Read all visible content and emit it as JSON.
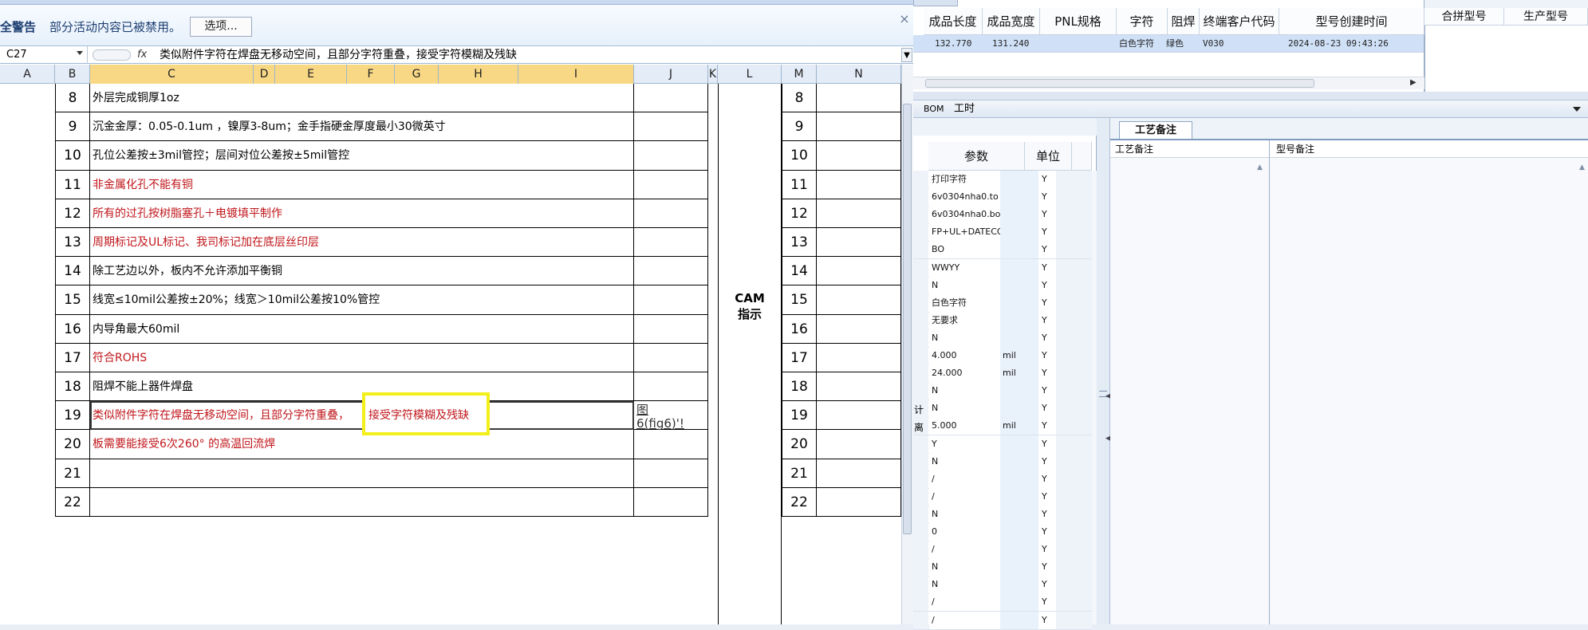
{
  "excel": {
    "security_title": "全警告",
    "security_message": "部分活动内容已被禁用。",
    "options_button": "选项...",
    "close_symbol": "×",
    "name_box": "C27",
    "fx_label": "fx",
    "formula_text": "类似附件字符在焊盘无移动空间，且部分字符重叠，接受字符模糊及残缺",
    "column_headers": [
      "A",
      "B",
      "C",
      "D",
      "E",
      "F",
      "G",
      "H",
      "I",
      "J",
      "K",
      "L",
      "M",
      "N"
    ],
    "rows": [
      {
        "num": "8",
        "text": "外层完成铜厚1oz",
        "red": false
      },
      {
        "num": "9",
        "text": "沉金金厚：0.05-0.1um ，镍厚3-8um；金手指硬金厚度最小30微英寸",
        "red": false
      },
      {
        "num": "10",
        "text": "孔位公差按±3mil管控；层间对位公差按±5mil管控",
        "red": false
      },
      {
        "num": "11",
        "text": "非金属化孔不能有铜",
        "red": true
      },
      {
        "num": "12",
        "text": "所有的过孔按树脂塞孔＋电镀填平制作",
        "red": true
      },
      {
        "num": "13",
        "text": "周期标记及UL标记、我司标记加在底层丝印层",
        "red": true
      },
      {
        "num": "14",
        "text": "除工艺边以外，板内不允许添加平衡铜",
        "red": false
      },
      {
        "num": "15",
        "text": "线宽≤10mil公差按±20%；线宽＞10mil公差按10%管控",
        "red": false
      },
      {
        "num": "16",
        "text": "内导角最大60mil",
        "red": false
      },
      {
        "num": "17",
        "text": "符合ROHS",
        "red": true
      },
      {
        "num": "18",
        "text": "阻焊不能上器件焊盘",
        "red": false
      },
      {
        "num": "19",
        "text": "类似附件字符在焊盘无移动空间，且部分字符重叠，",
        "red": true
      },
      {
        "num": "20",
        "text": "板需要能接受6次260° 的高温回流焊",
        "red": true
      },
      {
        "num": "21",
        "text": "",
        "red": false
      },
      {
        "num": "22",
        "text": "",
        "red": false
      }
    ],
    "highlight_text": "接受字符模糊及残缺",
    "fig_ref_line1": "图",
    "fig_ref_line2": "6(fig6)'!",
    "cam_label_line1": "CAM",
    "cam_label_line2": "指示"
  },
  "app": {
    "grid_headers": [
      "成品长度",
      "成品宽度",
      "PNL规格",
      "字符",
      "阻焊",
      "终端客户代码",
      "型号创建时间"
    ],
    "selected_row": {
      "length": "132.770",
      "width": "131.240",
      "pnl": "",
      "silkscreen": "白色字符",
      "solder_mask": "绿色",
      "customer_code": "V030",
      "created": "2024-08-23 09:43:26"
    },
    "merge_headers": [
      "合拼型号",
      "生产型号"
    ],
    "toolbar": {
      "bom": "BOM",
      "hours": "工时"
    },
    "param_headers": [
      "参数",
      "单位"
    ],
    "params": [
      {
        "value": "打印字符",
        "unit": "",
        "flag": "Y"
      },
      {
        "value": "6v0304nha0.to",
        "unit": "",
        "flag": "Y"
      },
      {
        "value": "6v0304nha0.bo",
        "unit": "",
        "flag": "Y"
      },
      {
        "value": "FP+UL+DATECODE",
        "unit": "",
        "flag": "Y"
      },
      {
        "value": "BO",
        "unit": "",
        "flag": "Y"
      },
      {
        "value": "WWYY",
        "unit": "",
        "flag": "Y"
      },
      {
        "value": "N",
        "unit": "",
        "flag": "Y"
      },
      {
        "value": "白色字符",
        "unit": "",
        "flag": "Y"
      },
      {
        "value": "无要求",
        "unit": "",
        "flag": "Y"
      },
      {
        "value": "N",
        "unit": "",
        "flag": "Y"
      },
      {
        "value": "4.000",
        "unit": "mil",
        "flag": "Y"
      },
      {
        "value": "24.000",
        "unit": "mil",
        "flag": "Y"
      },
      {
        "value": "N",
        "unit": "",
        "flag": "Y"
      },
      {
        "value": "N",
        "unit": "",
        "flag": "Y"
      },
      {
        "value": "5.000",
        "unit": "mil",
        "flag": "Y"
      },
      {
        "value": "Y",
        "unit": "",
        "flag": "Y"
      },
      {
        "value": "N",
        "unit": "",
        "flag": "Y"
      },
      {
        "value": "/",
        "unit": "",
        "flag": "Y"
      },
      {
        "value": "/",
        "unit": "",
        "flag": "Y"
      },
      {
        "value": "N",
        "unit": "",
        "flag": "Y"
      },
      {
        "value": "0",
        "unit": "",
        "flag": "Y"
      },
      {
        "value": "/",
        "unit": "",
        "flag": "Y"
      },
      {
        "value": "N",
        "unit": "",
        "flag": "Y"
      },
      {
        "value": "N",
        "unit": "",
        "flag": "Y"
      },
      {
        "value": "/",
        "unit": "",
        "flag": "Y"
      },
      {
        "value": "/",
        "unit": "",
        "flag": "Y"
      }
    ],
    "param_side_label1": "计",
    "param_side_label2": "离",
    "process_tab": "工艺备注",
    "notes_headers": [
      "工艺备注",
      "型号备注"
    ]
  }
}
